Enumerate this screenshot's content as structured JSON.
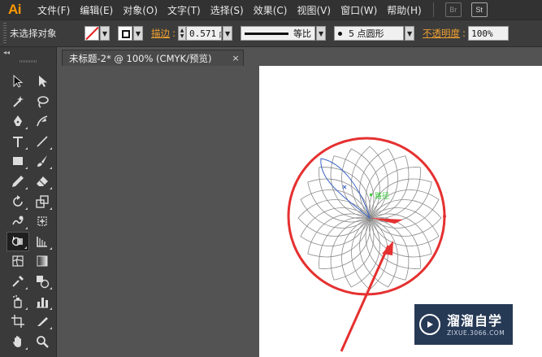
{
  "app": {
    "logo": "Ai",
    "accent_color": "#ff9a00"
  },
  "menu": {
    "items": [
      "文件(F)",
      "编辑(E)",
      "对象(O)",
      "文字(T)",
      "选择(S)",
      "效果(C)",
      "视图(V)",
      "窗口(W)",
      "帮助(H)"
    ],
    "bridge_label": "Br",
    "stock_label": "St"
  },
  "control": {
    "selection_status": "未选择对象",
    "stroke_label": "描边",
    "stroke_value": "0.571",
    "stroke_unit": "p",
    "profile_label": "等比",
    "brush_label": "5 点圆形",
    "opacity_label": "不透明度",
    "opacity_value": "100%"
  },
  "document": {
    "tab_title": "未标题-2* @ 100% (CMYK/预览)",
    "close_glyph": "×"
  },
  "canvas": {
    "smart_guide_label": "路径",
    "highlight_color": "#e53030",
    "path_color": "#8a8a8a",
    "selection_color": "#3a63c8"
  },
  "tools": [
    "selection-tool",
    "direct-selection-tool",
    "magic-wand-tool",
    "lasso-tool",
    "pen-tool",
    "curvature-tool",
    "type-tool",
    "line-segment-tool",
    "rectangle-tool",
    "paintbrush-tool",
    "pencil-tool",
    "eraser-tool",
    "rotate-tool",
    "scale-tool",
    "warp-tool",
    "free-transform-tool",
    "shape-builder-tool",
    "perspective-grid-tool",
    "mesh-tool",
    "gradient-tool",
    "eyedropper-tool",
    "blend-tool",
    "symbol-sprayer-tool",
    "column-graph-tool",
    "artboard-tool",
    "slice-tool",
    "hand-tool",
    "zoom-tool"
  ],
  "watermark": {
    "title": "溜溜自学",
    "url": "ZIXUE.3066.COM"
  }
}
